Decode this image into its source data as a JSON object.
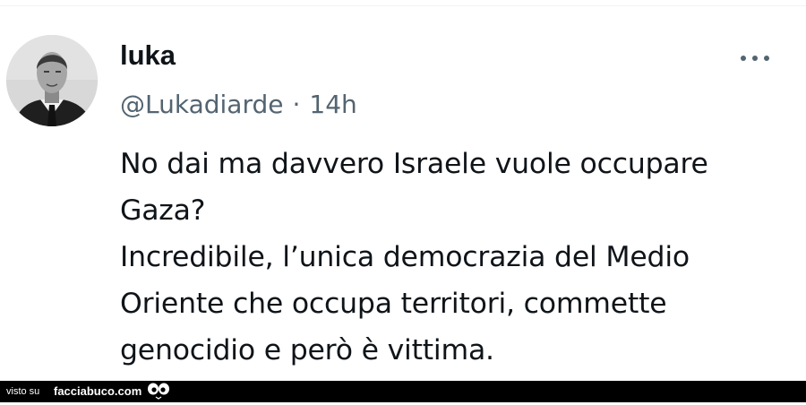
{
  "tweet": {
    "display_name": "luka",
    "handle": "@Lukadiarde",
    "separator": "·",
    "time": "14h",
    "text_lines": [
      "No dai ma davvero Israele vuole occupare",
      "Gaza?",
      "Incredibile, l’unica democrazia del Medio",
      "Oriente che occupa territori, commette",
      "genocidio e però è vittima."
    ],
    "icons": {
      "more": "more-horizontal-icon",
      "avatar": "profile-photo"
    }
  },
  "footer": {
    "visto_su": "visto su",
    "brand": "facciabuco.com",
    "logo_icon": "eyes-logo-icon"
  },
  "colors": {
    "text_primary": "#0f1419",
    "text_secondary": "#536471",
    "footer_bg": "#000000",
    "footer_text": "#ffffff"
  }
}
